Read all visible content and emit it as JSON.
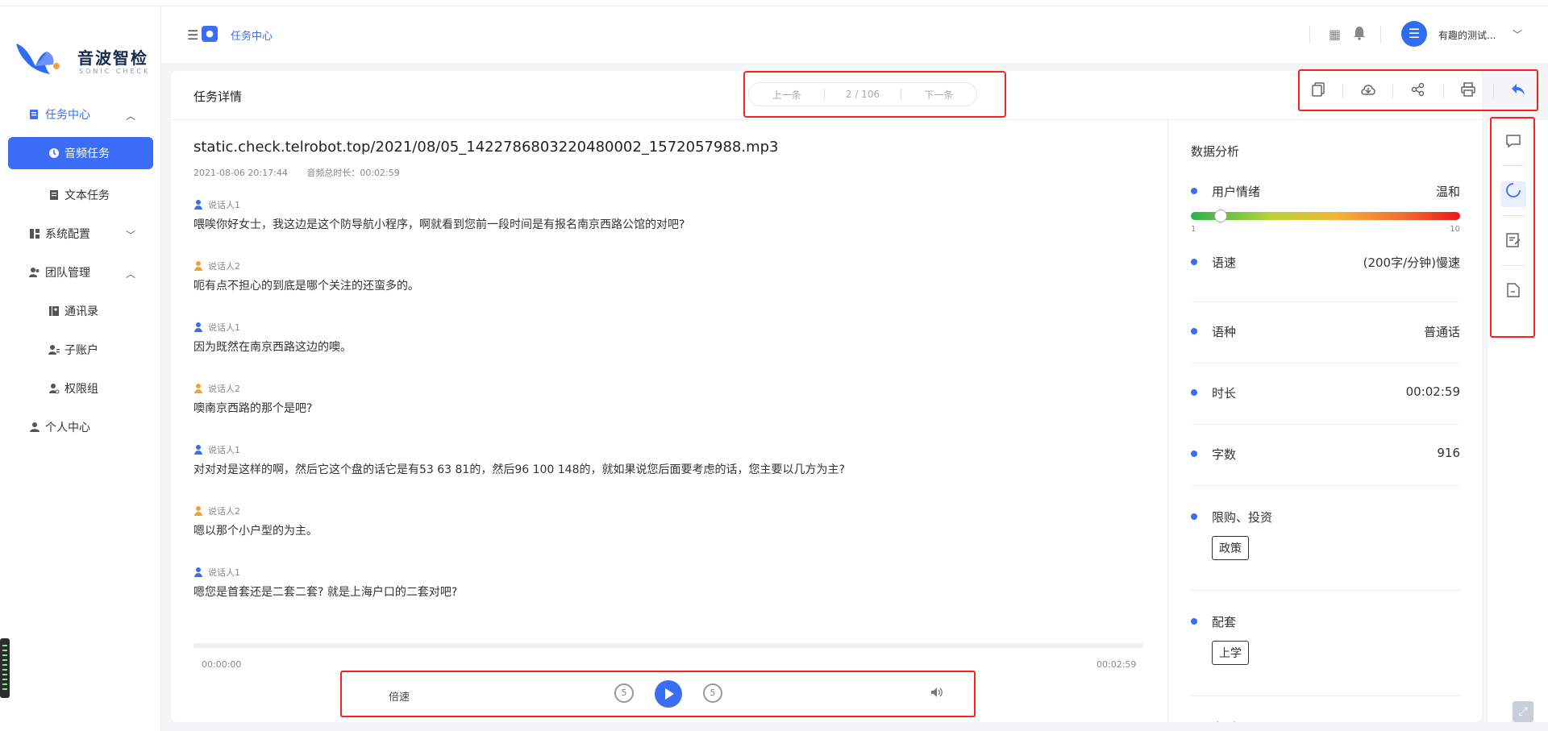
{
  "brand": {
    "name": "音波智检",
    "tagline": "SONIC CHECK"
  },
  "sidebar": {
    "items": [
      {
        "label": "任务中心",
        "type": "parent",
        "expanded": true,
        "active": true,
        "icon": "task-icon"
      },
      {
        "label": "音频任务",
        "type": "child",
        "active": true,
        "icon": "audio-icon"
      },
      {
        "label": "文本任务",
        "type": "child",
        "icon": "text-doc-icon"
      },
      {
        "label": "系统配置",
        "type": "parent",
        "expanded": false,
        "icon": "config-icon"
      },
      {
        "label": "团队管理",
        "type": "parent",
        "expanded": true,
        "icon": "team-icon"
      },
      {
        "label": "通讯录",
        "type": "child",
        "icon": "contacts-icon"
      },
      {
        "label": "子账户",
        "type": "child",
        "icon": "subaccount-icon"
      },
      {
        "label": "权限组",
        "type": "child",
        "icon": "permission-icon"
      },
      {
        "label": "个人中心",
        "type": "parent",
        "icon": "user-icon"
      }
    ]
  },
  "header": {
    "breadcrumb": "任务中心",
    "user_name": "有趣的测试..."
  },
  "detail": {
    "title": "任务详情",
    "pager": {
      "prev": "上一条",
      "position": "2 / 106",
      "next": "下一条"
    },
    "actions": [
      "copy-icon",
      "download-icon",
      "share-icon",
      "print-icon",
      "back-icon"
    ]
  },
  "transcript": {
    "file_name": "static.check.telrobot.top/2021/08/05_1422786803220480002_1572057988.mp3",
    "datetime": "2021-08-06 20:17:44",
    "duration_label": "音频总时长：00:02:59",
    "messages": [
      {
        "speaker": "说话人1",
        "text": "喂唉你好女士，我这边是这个防导航小程序，啊就看到您前一段时间是有报名南京西路公馆的对吧?"
      },
      {
        "speaker": "说话人2",
        "text": "呃有点不担心的到底是哪个关注的还蛮多的。"
      },
      {
        "speaker": "说话人1",
        "text": "因为既然在南京西路这边的噢。"
      },
      {
        "speaker": "说话人2",
        "text": "噢南京西路的那个是吧?"
      },
      {
        "speaker": "说话人1",
        "text": "对对对是这样的啊，然后它这个盘的话它是有53 63 81的，然后96 100 148的，就如果说您后面要考虑的话，您主要以几方为主?"
      },
      {
        "speaker": "说话人2",
        "text": "嗯以那个小户型的为主。"
      },
      {
        "speaker": "说话人1",
        "text": "嗯您是首套还是二套二套? 就是上海户口的二套对吧?"
      }
    ]
  },
  "player": {
    "time_start": "00:00:00",
    "time_end": "00:02:59",
    "progress": 0.0,
    "speed_label": "倍速",
    "rewind_label": "5",
    "forward_label": "5"
  },
  "analysis": {
    "title": "数据分析",
    "rows": [
      {
        "label": "用户情绪",
        "value": "温和",
        "gauge": {
          "min": "1",
          "max": "10",
          "level": 2
        }
      },
      {
        "label": "语速",
        "value": "(200字/分钟)慢速"
      },
      {
        "label": "语种",
        "value": "普通话"
      },
      {
        "label": "时长",
        "value": "00:02:59"
      },
      {
        "label": "字数",
        "value": "916"
      },
      {
        "label": "限购、投资",
        "tag": "政策"
      },
      {
        "label": "配套",
        "tag": "上学"
      },
      {
        "label": "户型"
      }
    ]
  },
  "side_tools": [
    "comments-icon",
    "loading-ring-icon",
    "edit-note-icon",
    "document-icon"
  ],
  "colors": {
    "accent": "#3b6ef5",
    "speaker2": "#f2a23c",
    "highlight_border": "#ff1f1f"
  }
}
